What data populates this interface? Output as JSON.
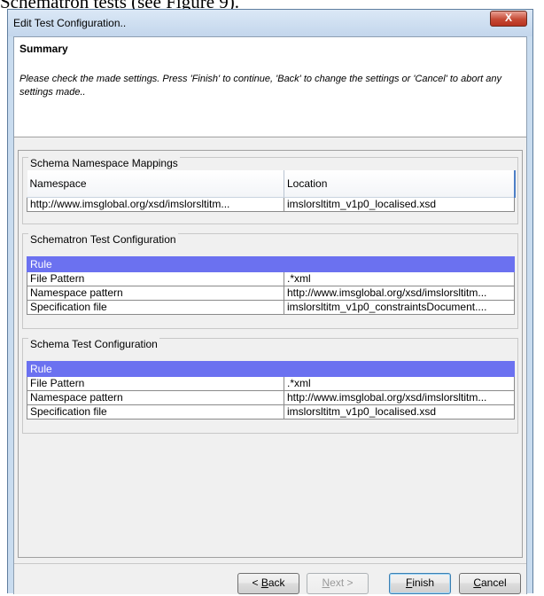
{
  "document_caption": "Schematron tests (see Figure 9).",
  "window": {
    "title": "Edit Test Configuration..",
    "close_label": "X"
  },
  "header": {
    "title": "Summary",
    "description": "Please check the made settings. Press 'Finish' to continue, 'Back' to change the settings or 'Cancel' to abort any settings made.."
  },
  "namespace_group": {
    "title": "Schema Namespace Mappings",
    "columns": [
      "Namespace",
      "Location"
    ],
    "rows": [
      [
        "http://www.imsglobal.org/xsd/imslorsltitm...",
        "imslorsltitm_v1p0_localised.xsd"
      ]
    ]
  },
  "schematron_group": {
    "title": "Schematron Test Configuration",
    "header": "Rule",
    "rows": [
      [
        "File Pattern",
        ".*xml"
      ],
      [
        "Namespace pattern",
        "http://www.imsglobal.org/xsd/imslorsltitm..."
      ],
      [
        "Specification file",
        "imslorsltitm_v1p0_constraintsDocument...."
      ]
    ]
  },
  "schema_group": {
    "title": "Schema Test Configuration",
    "header": "Rule",
    "rows": [
      [
        "File Pattern",
        ".*xml"
      ],
      [
        "Namespace pattern",
        "http://www.imsglobal.org/xsd/imslorsltitm..."
      ],
      [
        "Specification file",
        "imslorsltitm_v1p0_localised.xsd"
      ]
    ]
  },
  "buttons": {
    "back": {
      "prefix": "< ",
      "mnemonic": "B",
      "rest": "ack"
    },
    "next": {
      "mnemonic": "N",
      "rest": "ext >"
    },
    "finish": {
      "mnemonic": "F",
      "rest": "inish"
    },
    "cancel": {
      "mnemonic": "C",
      "rest": "ancel"
    }
  }
}
